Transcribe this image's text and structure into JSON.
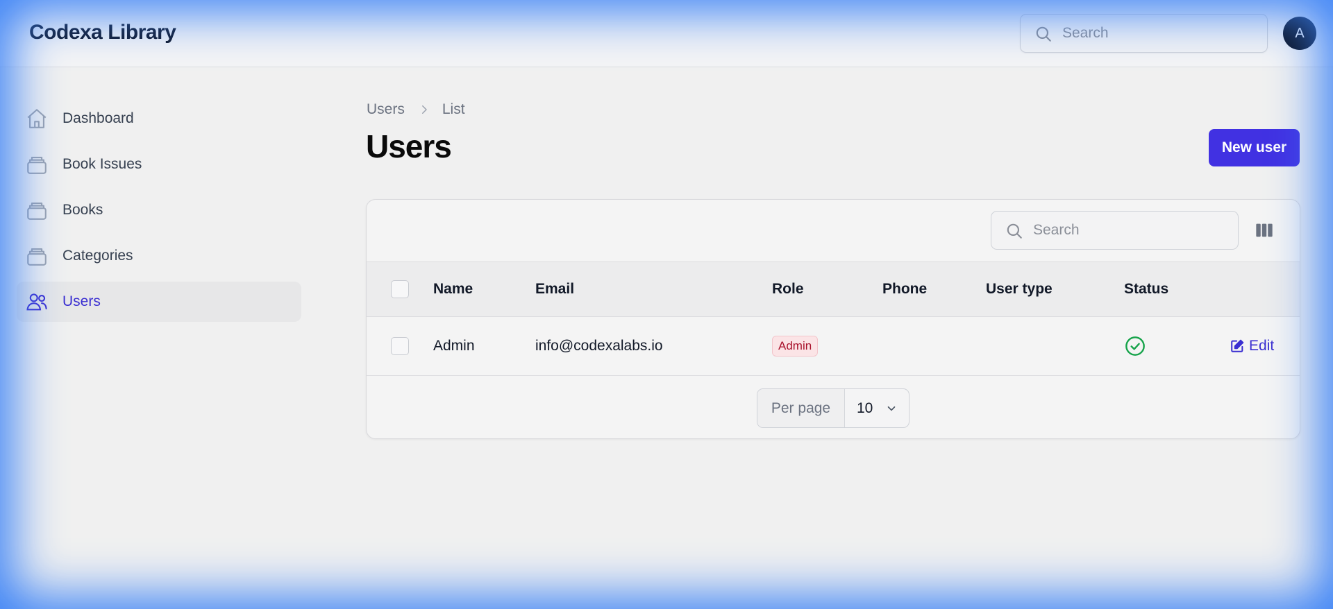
{
  "app": {
    "title": "Codexa Library"
  },
  "header": {
    "search_placeholder": "Search",
    "avatar_initial": "A"
  },
  "sidebar": {
    "items": [
      {
        "label": "Dashboard",
        "icon": "home-icon",
        "active": false
      },
      {
        "label": "Book Issues",
        "icon": "stack-icon",
        "active": false
      },
      {
        "label": "Books",
        "icon": "stack-icon",
        "active": false
      },
      {
        "label": "Categories",
        "icon": "stack-icon",
        "active": false
      },
      {
        "label": "Users",
        "icon": "users-icon",
        "active": true
      }
    ]
  },
  "breadcrumb": {
    "parent": "Users",
    "current": "List"
  },
  "page": {
    "title": "Users",
    "new_button": "New user"
  },
  "table": {
    "search_placeholder": "Search",
    "columns": [
      "Name",
      "Email",
      "Role",
      "Phone",
      "User type",
      "Status"
    ],
    "rows": [
      {
        "name": "Admin",
        "email": "info@codexalabs.io",
        "role": "Admin",
        "phone": "",
        "user_type": "",
        "status": "active",
        "action": "Edit"
      }
    ],
    "pagination": {
      "per_page_label": "Per page",
      "per_page_value": "10"
    }
  },
  "colors": {
    "accent": "#4131e2",
    "active_nav_text": "#3b2fd1",
    "badge_text": "#a8112b",
    "status_ok": "#16a34a"
  }
}
